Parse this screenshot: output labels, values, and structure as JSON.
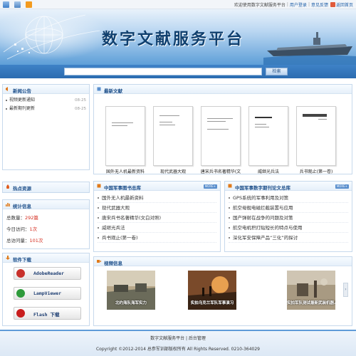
{
  "topbar": {
    "welcome": "欢迎使用数字文献服务平台",
    "login": "用户登录",
    "feedback": "意见反馈",
    "home": "返回首页",
    "sep": "|"
  },
  "banner": {
    "title": "数字文献服务平台"
  },
  "search": {
    "placeholder": "",
    "button": "检索"
  },
  "news": {
    "title": "新闻公告",
    "items": [
      {
        "label": "视频更新通知",
        "date": "08-25"
      },
      {
        "label": "最新期刊更新",
        "date": "08-25"
      }
    ]
  },
  "latest": {
    "title": "最新文献",
    "books": [
      {
        "caption": "国外无人机最新资料"
      },
      {
        "caption": "现代武器大观"
      },
      {
        "caption": "唐宋兵书名著精华(文"
      },
      {
        "caption": "威继光兵法"
      },
      {
        "caption": "兵书观止(第一卷)"
      }
    ]
  },
  "hot": {
    "title": "热点资源"
  },
  "library": {
    "title": "中国军事图书总库",
    "more": "MORE+",
    "items": [
      "国外无人机最新资料",
      "现代武器大观",
      "唐宋兵书名著精华(文白对照)",
      "威继光兵法",
      "兵书观止(第一卷)"
    ]
  },
  "thesis": {
    "title": "中国军事数字期刊论文总库",
    "more": "MORE+",
    "items": [
      "GPS系统的军事利用及对策",
      "航空母舰电磁拦截装置与应用",
      "国产弹射在战争的问题及对策",
      "航空电机积打贴短长的特点与使用",
      "深化军安保障产品“三化”的探讨"
    ]
  },
  "stats": {
    "title": "统计信息",
    "rows": [
      {
        "label": "总数量：",
        "value": "292篇"
      },
      {
        "label": "今日访问：",
        "value": "1次"
      },
      {
        "label": "总访问量：",
        "value": "101次"
      }
    ]
  },
  "software": {
    "title": "软件下载",
    "items": [
      {
        "label": "AdobeReader",
        "color": "#c8302a"
      },
      {
        "label": "LampViewer",
        "color": "#2e9a3b"
      },
      {
        "label": "Flash 下载",
        "color": "#c81d1d"
      }
    ]
  },
  "video": {
    "title": "视频信息",
    "items": [
      {
        "caption": "北约海队海军实力"
      },
      {
        "caption": "实拍乌克兰军队军事演习"
      },
      {
        "caption": "实拍军队测试最新武装机器人"
      }
    ]
  },
  "footer": {
    "line1": "数字文献服务平台 | 后台管理",
    "line2": "Copyright ©2012-2014 总参军训部版权所有  All Rights Reserved.  0210-364029"
  },
  "colors": {
    "accent": "#2c6cb0",
    "stat_value": "#d42a1c",
    "heading": "#1d4f8a"
  }
}
